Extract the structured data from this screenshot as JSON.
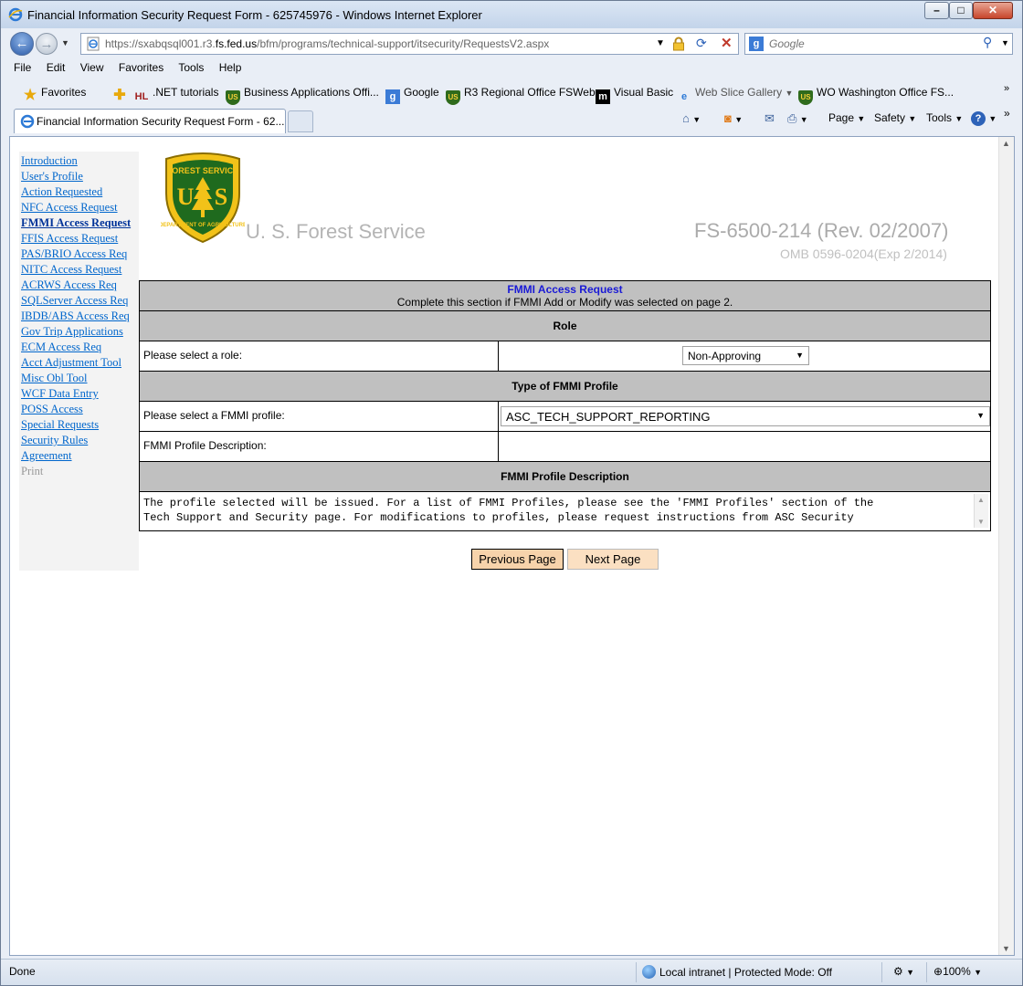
{
  "window": {
    "title": "Financial Information Security Request Form - 625745976 - Windows Internet Explorer"
  },
  "address": {
    "url_prefix": "https://sxabqsql001.r3.",
    "url_host": "fs.fed.us",
    "url_path": "/bfm/programs/technical-support/itsecurity/RequestsV2.aspx"
  },
  "search": {
    "placeholder": "Google"
  },
  "menu": [
    "File",
    "Edit",
    "View",
    "Favorites",
    "Tools",
    "Help"
  ],
  "favorites": {
    "label": "Favorites",
    "items": [
      ".NET tutorials",
      "Business Applications Offi...",
      "Google",
      "R3 Regional Office FSWeb",
      "Visual Basic",
      "Web Slice Gallery",
      "WO Washington Office FS..."
    ]
  },
  "tab": {
    "label": "Financial Information Security Request Form - 62..."
  },
  "commands": {
    "page": "Page",
    "safety": "Safety",
    "tools": "Tools"
  },
  "leftnav": {
    "items": [
      "Introduction",
      "User's Profile",
      "Action Requested",
      "NFC Access Request",
      "FMMI Access Request",
      "FFIS Access Request",
      "PAS/BRIO Access Req",
      "NITC Access Request",
      "ACRWS Access Req",
      "SQLServer Access Req",
      "IBDB/ABS Access Req",
      "Gov Trip Applications",
      "ECM Access Req",
      "Acct Adjustment Tool",
      "Misc Obl Tool",
      "WCF Data Entry",
      "POSS Access",
      "Special Requests",
      "Security Rules",
      "Agreement"
    ],
    "print": "Print"
  },
  "header": {
    "agency": "U. S. Forest Service",
    "form_number": "FS-6500-214 (Rev. 02/2007)",
    "omb": "OMB 0596-0204(Exp 2/2014)"
  },
  "form": {
    "title": "FMMI Access Request",
    "subtitle": "Complete this section if FMMI Add or Modify was selected on page 2.",
    "role_header": "Role",
    "role_label": "Please select a role:",
    "role_value": "Non-Approving",
    "profile_type_header": "Type of FMMI Profile",
    "profile_label": "Please select a FMMI profile:",
    "profile_value": "ASC_TECH_SUPPORT_REPORTING",
    "profile_desc_label": "FMMI Profile Description:",
    "profile_desc_header": "FMMI Profile Description",
    "desc_line1": "The profile selected will be issued. For a list of FMMI Profiles, please see the 'FMMI Profiles' section of the",
    "desc_line2": "Tech Support and Security page. For modifications to profiles, please request instructions from ASC Security"
  },
  "buttons": {
    "previous": "Previous Page",
    "next": "Next Page"
  },
  "status": {
    "text": "Done",
    "zone": "Local intranet | Protected Mode: Off",
    "zoom": "100%"
  }
}
